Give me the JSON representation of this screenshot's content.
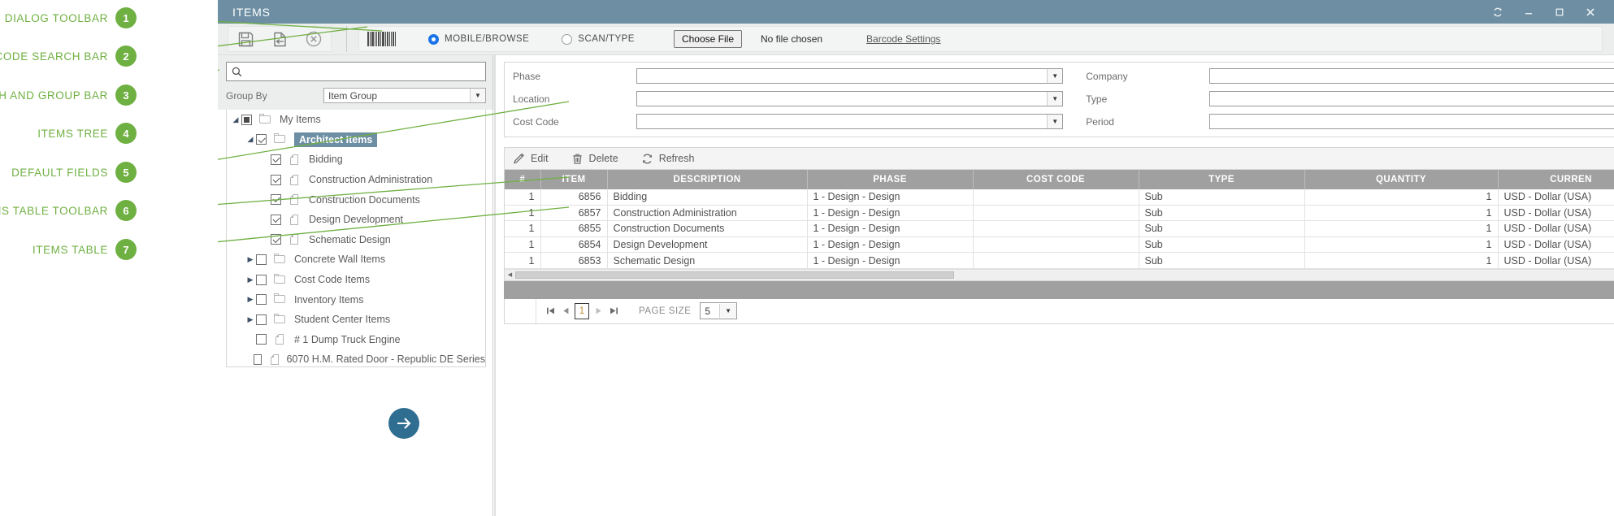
{
  "annotations": [
    {
      "num": "1",
      "label": "DIALOG TOOLBAR"
    },
    {
      "num": "2",
      "label": "BARCODE SEARCH BAR"
    },
    {
      "num": "3",
      "label": "SEARCH AND GROUP BAR"
    },
    {
      "num": "4",
      "label": "ITEMS TREE"
    },
    {
      "num": "5",
      "label": "DEFAULT FIELDS"
    },
    {
      "num": "6",
      "label": "ITEMS TABLE TOOLBAR"
    },
    {
      "num": "7",
      "label": "ITEMS TABLE"
    }
  ],
  "window": {
    "title": "ITEMS",
    "controls": [
      {
        "name": "refresh-icon",
        "glyph": "↻"
      },
      {
        "name": "minimize-icon",
        "glyph": "–"
      },
      {
        "name": "maximize-icon",
        "glyph": "□"
      },
      {
        "name": "close-icon",
        "glyph": "✕"
      }
    ]
  },
  "dialog_toolbar": {
    "buttons": [
      {
        "name": "save-icon",
        "title": "Save"
      },
      {
        "name": "save-and-return-icon",
        "title": "Save and Return"
      },
      {
        "name": "cancel-icon",
        "title": "Cancel"
      }
    ]
  },
  "barcode_bar": {
    "barcode_icon": "barcode-icon",
    "mode_options": [
      {
        "label": "MOBILE/BROWSE",
        "selected": true
      },
      {
        "label": "SCAN/TYPE",
        "selected": false
      }
    ],
    "choose_file_label": "Choose File",
    "file_status": "No file chosen",
    "settings_link": "Barcode Settings"
  },
  "search_group": {
    "search_placeholder": "",
    "search_value": "",
    "group_by_label": "Group By",
    "group_by_value": "Item Group"
  },
  "tree": {
    "nodes": [
      {
        "label": "My Items",
        "indent": 0,
        "twisty": "down",
        "check": "partial",
        "icon": "folder",
        "selected": false
      },
      {
        "label": "Architect Items",
        "indent": 1,
        "twisty": "down",
        "check": "checked",
        "icon": "folder",
        "selected": true
      },
      {
        "label": "Bidding",
        "indent": 2,
        "twisty": "none",
        "check": "checked",
        "icon": "doc",
        "selected": false
      },
      {
        "label": "Construction Administration",
        "indent": 2,
        "twisty": "none",
        "check": "checked",
        "icon": "doc",
        "selected": false
      },
      {
        "label": "Construction Documents",
        "indent": 2,
        "twisty": "none",
        "check": "checked",
        "icon": "doc",
        "selected": false
      },
      {
        "label": "Design Development",
        "indent": 2,
        "twisty": "none",
        "check": "checked",
        "icon": "doc",
        "selected": false
      },
      {
        "label": "Schematic Design",
        "indent": 2,
        "twisty": "none",
        "check": "checked",
        "icon": "doc",
        "selected": false
      },
      {
        "label": "Concrete Wall Items",
        "indent": 1,
        "twisty": "right",
        "check": "none",
        "icon": "folder",
        "selected": false
      },
      {
        "label": "Cost Code Items",
        "indent": 1,
        "twisty": "right",
        "check": "none",
        "icon": "folder",
        "selected": false
      },
      {
        "label": "Inventory Items",
        "indent": 1,
        "twisty": "right",
        "check": "none",
        "icon": "folder",
        "selected": false
      },
      {
        "label": "Student Center Items",
        "indent": 1,
        "twisty": "right",
        "check": "none",
        "icon": "folder",
        "selected": false
      },
      {
        "label": "# 1 Dump Truck Engine",
        "indent": 1,
        "twisty": "none",
        "check": "none",
        "icon": "doc",
        "selected": false
      },
      {
        "label": "6070 H.M. Rated Door - Republic DE Series",
        "indent": 1,
        "twisty": "none",
        "check": "none",
        "icon": "doc",
        "selected": false
      }
    ],
    "next_button": "next-arrow-button"
  },
  "default_fields": {
    "rows": [
      [
        {
          "label": "Phase",
          "value": ""
        },
        {
          "label": "Company",
          "value": ""
        }
      ],
      [
        {
          "label": "Location",
          "value": ""
        },
        {
          "label": "Type",
          "value": ""
        }
      ],
      [
        {
          "label": "Cost Code",
          "value": ""
        },
        {
          "label": "Period",
          "value": ""
        }
      ]
    ]
  },
  "table_toolbar": {
    "buttons": [
      {
        "name": "edit-button",
        "label": "Edit",
        "icon": "pencil-icon"
      },
      {
        "name": "delete-button",
        "label": "Delete",
        "icon": "trash-icon"
      },
      {
        "name": "refresh-button",
        "label": "Refresh",
        "icon": "refresh-icon"
      }
    ]
  },
  "items_table": {
    "columns": [
      "#",
      "ITEM",
      "DESCRIPTION",
      "PHASE",
      "COST CODE",
      "TYPE",
      "QUANTITY",
      "CURREN"
    ],
    "rows": [
      [
        "1",
        "6856",
        "Bidding",
        "1 - Design - Design",
        "",
        "Sub",
        "1",
        "USD - Dollar (USA)"
      ],
      [
        "1",
        "6857",
        "Construction Administration",
        "1 - Design - Design",
        "",
        "Sub",
        "1",
        "USD - Dollar (USA)"
      ],
      [
        "1",
        "6855",
        "Construction Documents",
        "1 - Design - Design",
        "",
        "Sub",
        "1",
        "USD - Dollar (USA)"
      ],
      [
        "1",
        "6854",
        "Design Development",
        "1 - Design - Design",
        "",
        "Sub",
        "1",
        "USD - Dollar (USA)"
      ],
      [
        "1",
        "6853",
        "Schematic Design",
        "1 - Design - Design",
        "",
        "Sub",
        "1",
        "USD - Dollar (USA)"
      ]
    ]
  },
  "pager": {
    "first_label": "⏮",
    "prev_label": "◀",
    "page_number": "1",
    "next_label": "▶",
    "last_label": "⏭",
    "page_size_label": "PAGE SIZE",
    "page_size_value": "5"
  },
  "colors": {
    "title_bar": "#6d8ea3",
    "annotation_green": "#6fb042",
    "accent_blue": "#2f6e91",
    "header_gray": "#a0a0a0",
    "selection": "#6d8ea3"
  }
}
